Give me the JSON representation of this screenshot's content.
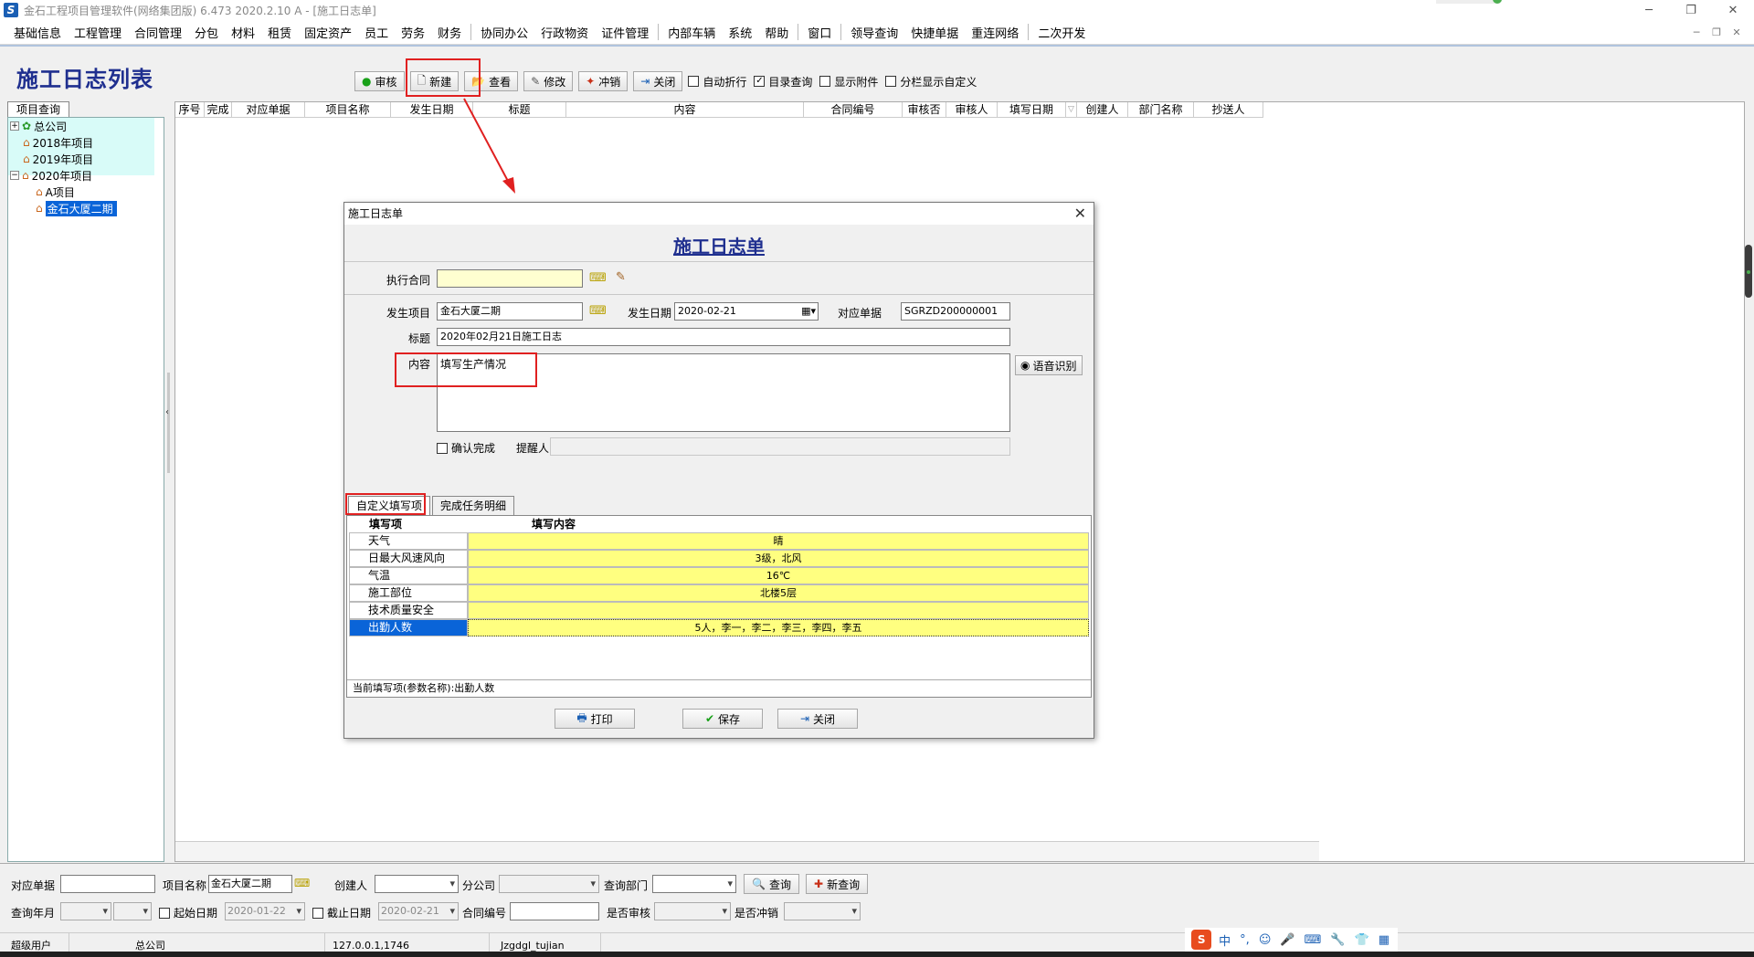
{
  "window": {
    "title": "金石工程项目管理软件(网络集团版) 6.473  2020.2.10 A - [施工日志单]",
    "app_icon": "S",
    "min": "─",
    "max": "❐",
    "close": "✕"
  },
  "menu": [
    "基础信息",
    "工程管理",
    "合同管理",
    "分包",
    "材料",
    "租赁",
    "固定资产",
    "员工",
    "劳务",
    "财务",
    "|",
    "协同办公",
    "行政物资",
    "证件管理",
    "|",
    "内部车辆",
    "系统",
    "帮助",
    "|",
    "窗口",
    "|",
    "领导查询",
    "快捷单据",
    "重连网络",
    "|",
    "二次开发"
  ],
  "mdi": {
    "min": "─",
    "restore": "❐",
    "close": "✕"
  },
  "list": {
    "title": "施工日志列表",
    "toolbar": [
      {
        "name": "audit-button",
        "icon": "●",
        "icon_color": "#18a018",
        "label": "审核"
      },
      {
        "name": "new-button",
        "icon": "🗋",
        "icon_color": "#333333",
        "label": "新建"
      },
      {
        "name": "view-button",
        "icon": "📂",
        "icon_color": "#c8a018",
        "label": "查看"
      },
      {
        "name": "edit-button",
        "icon": "✎",
        "icon_color": "#555555",
        "label": "修改"
      },
      {
        "name": "reverse-button",
        "icon": "✦",
        "icon_color": "#c83018",
        "label": "冲销"
      },
      {
        "name": "close-button",
        "icon": "⇥",
        "icon_color": "#1a5fb4",
        "label": "关闭"
      }
    ],
    "checks": [
      {
        "label": "自动折行",
        "checked": false
      },
      {
        "label": "目录查询",
        "checked": true
      },
      {
        "label": "显示附件",
        "checked": false
      },
      {
        "label": "分栏显示自定义",
        "checked": false
      }
    ],
    "tree_tab": "项目查询",
    "tree": [
      {
        "label": "总公司",
        "level": 0,
        "exp": "+",
        "icon": "globe"
      },
      {
        "label": "2018年项目",
        "level": 1,
        "exp": "",
        "icon": "home"
      },
      {
        "label": "2019年项目",
        "level": 1,
        "exp": "",
        "icon": "home"
      },
      {
        "label": "2020年项目",
        "level": 0,
        "exp": "−",
        "icon": "home"
      },
      {
        "label": "A项目",
        "level": 2,
        "exp": "",
        "icon": "home"
      },
      {
        "label": "金石大厦二期",
        "level": 2,
        "exp": "",
        "icon": "home"
      }
    ],
    "columns": [
      "序号",
      "完成",
      "对应单据",
      "项目名称",
      "发生日期",
      "标题",
      "内容",
      "合同编号",
      "审核否",
      "审核人",
      "填写日期",
      "创建人",
      "部门名称",
      "抄送人"
    ],
    "sort_indicator": "▽"
  },
  "dialog": {
    "title": "施工日志单",
    "heading": "施工日志单",
    "labels": {
      "contract": "执行合同",
      "project": "发生项目",
      "date": "发生日期",
      "doc": "对应单据",
      "subject": "标题",
      "content": "内容",
      "confirm": "确认完成",
      "reminder": "提醒人"
    },
    "values": {
      "contract": "",
      "project": "金石大厦二期",
      "date": "2020-02-21",
      "doc": "SGRZD200000001",
      "subject": "2020年02月21日施工日志",
      "content": "填写生产情况",
      "reminder": ""
    },
    "voice_button": "语音识别",
    "tabs": [
      "自定义填写项",
      "完成任务明细"
    ],
    "grid_headers": [
      "填写项",
      "填写内容"
    ],
    "rows": [
      {
        "k": "天气",
        "v": "晴"
      },
      {
        "k": "日最大风速风向",
        "v": "3级，北风"
      },
      {
        "k": "气温",
        "v": "16℃"
      },
      {
        "k": "施工部位",
        "v": "北楼5层"
      },
      {
        "k": "技术质量安全",
        "v": ""
      },
      {
        "k": "出勤人数",
        "v": "5人，李一，李二，李三，李四，李五"
      }
    ],
    "grid_status": "当前填写项(参数名称):出勤人数",
    "buttons": {
      "print": "打印",
      "save": "保存",
      "close": "关闭"
    }
  },
  "query": {
    "labels": {
      "doc": "对应单据",
      "project": "项目名称",
      "creator": "创建人",
      "branch": "分公司",
      "dept": "查询部门",
      "month": "查询年月",
      "start": "起始日期",
      "end": "截止日期",
      "contract": "合同编号",
      "audited": "是否审核",
      "reversed": "是否冲销"
    },
    "values": {
      "doc": "",
      "project": "金石大厦二期",
      "creator": "",
      "branch": "",
      "dept": "",
      "start": "2020-01-22",
      "end": "2020-02-21",
      "contract": ""
    },
    "query_button": "查询",
    "new_query_button": "新查询"
  },
  "status": {
    "user": "超级用户",
    "company": "总公司",
    "ip": "127.0.0.1,1746",
    "db": "Jzgdgl_tujian"
  },
  "ime": [
    "中",
    "°,",
    "☺",
    "🎤",
    "⌨",
    "🔧",
    "👕",
    "▦"
  ],
  "colors": {
    "title_blue": "#1f2f8f",
    "selection": "#0a64d8",
    "grid_yellow": "#ffff80",
    "tree_cyan": "#d8fbf8",
    "annotation_red": "#e02020"
  }
}
